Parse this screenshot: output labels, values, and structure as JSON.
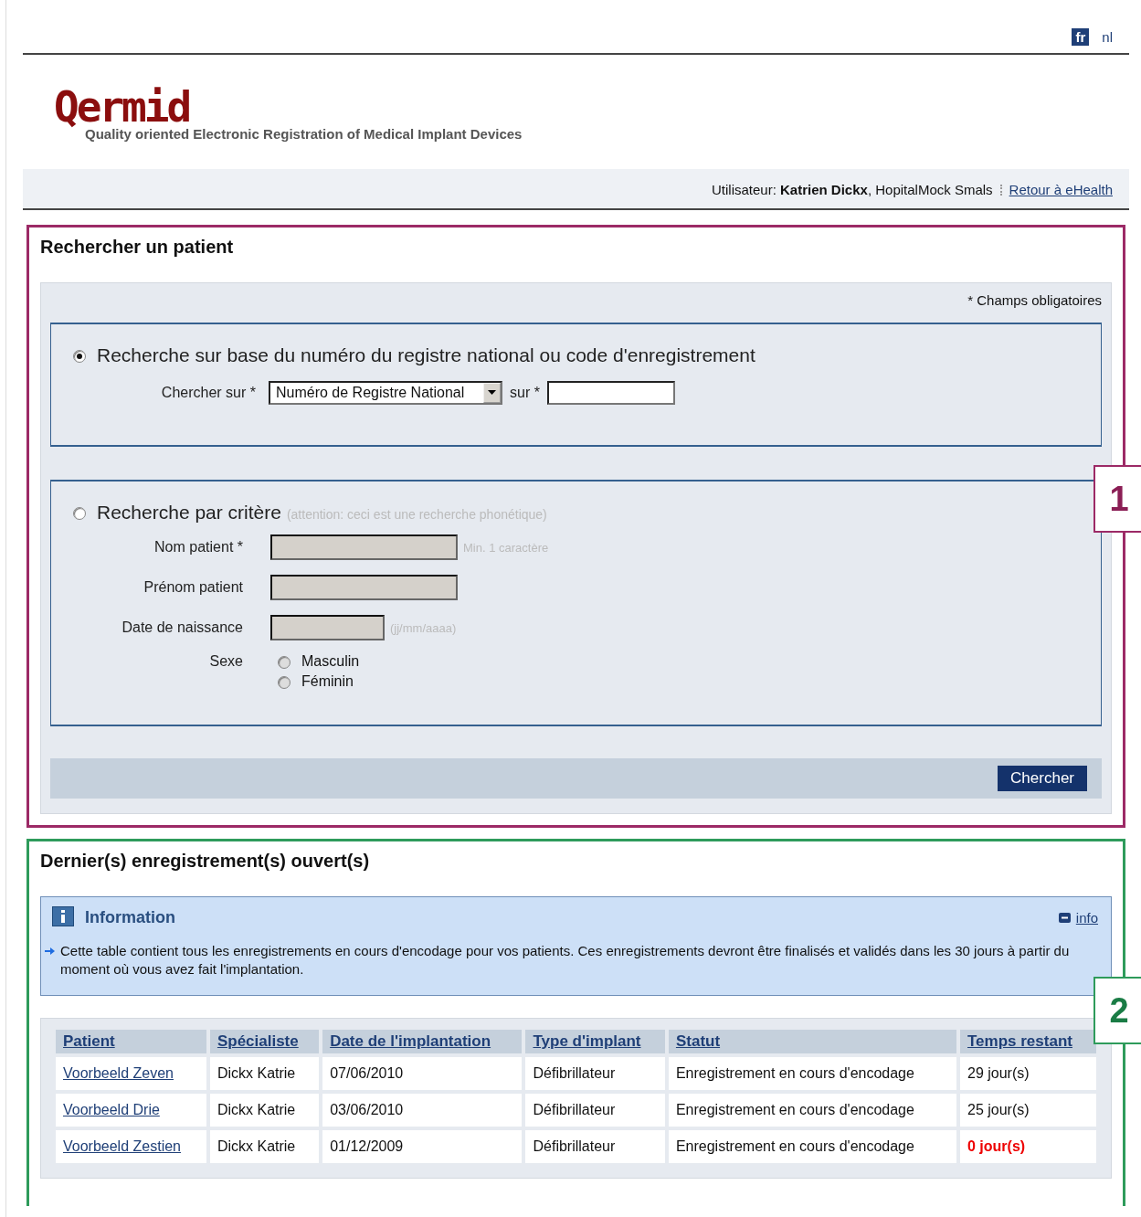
{
  "languages": [
    {
      "label": "fr",
      "selected": true
    },
    {
      "label": "nl",
      "selected": false
    }
  ],
  "logo": {
    "name": "Qermid",
    "tagline": "Quality oriented Electronic Registration of Medical Implant Devices"
  },
  "user_bar": {
    "user": "Utilisateur: **Katrien Dickx**, HopitalMock Smals",
    "link": "Retour à eHealth"
  },
  "search_panel": {
    "title": "Rechercher un patient",
    "callout": "1",
    "required_note": "* Champs obligatoires",
    "national": {
      "selected": true,
      "label": "Recherche sur base du numéro du registre national ou code d'enregistrement",
      "search_on_label": "Chercher sur *",
      "select_value": "Numéro de Registre National",
      "value_label": "sur *"
    },
    "criteria": {
      "selected": false,
      "label": "Recherche par critère",
      "hint": "(attention: ceci est une recherche phonétique)",
      "fields": [
        {
          "label": "Nom patient *",
          "hint": "Min. 1 caractère",
          "kind": "wide",
          "disabled": true
        },
        {
          "label": "Prénom patient",
          "kind": "wide",
          "disabled": true
        },
        {
          "label": "Date de naissance",
          "hint": "(jj/mm/aaaa)",
          "kind": "short",
          "disabled": true
        }
      ],
      "sex": {
        "label": "Sexe",
        "options": [
          {
            "label": "Masculin",
            "selected": false
          },
          {
            "label": "Féminin",
            "selected": false
          }
        ]
      }
    },
    "button": "Chercher"
  },
  "recent_panel": {
    "title": "Dernier(s) enregistrement(s) ouvert(s)",
    "callout": "2",
    "info": {
      "title": "Information",
      "toggle": "info",
      "text": "Cette table contient tous les enregistrements en cours d'encodage pour vos patients. Ces enregistrements devront être finalisés et validés dans les 30 jours à partir du moment où vous avez fait l'implantation."
    },
    "table": {
      "columns": [
        "Patient",
        "Spécialiste",
        "Date de l'implantation",
        "Type d'implant",
        "Statut",
        "Temps restant"
      ],
      "rows": [
        {
          "cells": [
            "Voorbeeld Zeven",
            "Dickx Katrie",
            "07/06/2010",
            "Défibrillateur",
            "Enregistrement en cours d'encodage",
            "29 jour(s)"
          ],
          "overdue": false
        },
        {
          "cells": [
            "Voorbeeld Drie",
            "Dickx Katrie",
            "03/06/2010",
            "Défibrillateur",
            "Enregistrement en cours d'encodage",
            "25 jour(s)"
          ],
          "overdue": false
        },
        {
          "cells": [
            "Voorbeeld Zestien",
            "Dickx Katrie",
            "01/12/2009",
            "Défibrillateur",
            "Enregistrement en cours d'encodage",
            "0 jour(s)"
          ],
          "overdue": true
        }
      ]
    }
  }
}
